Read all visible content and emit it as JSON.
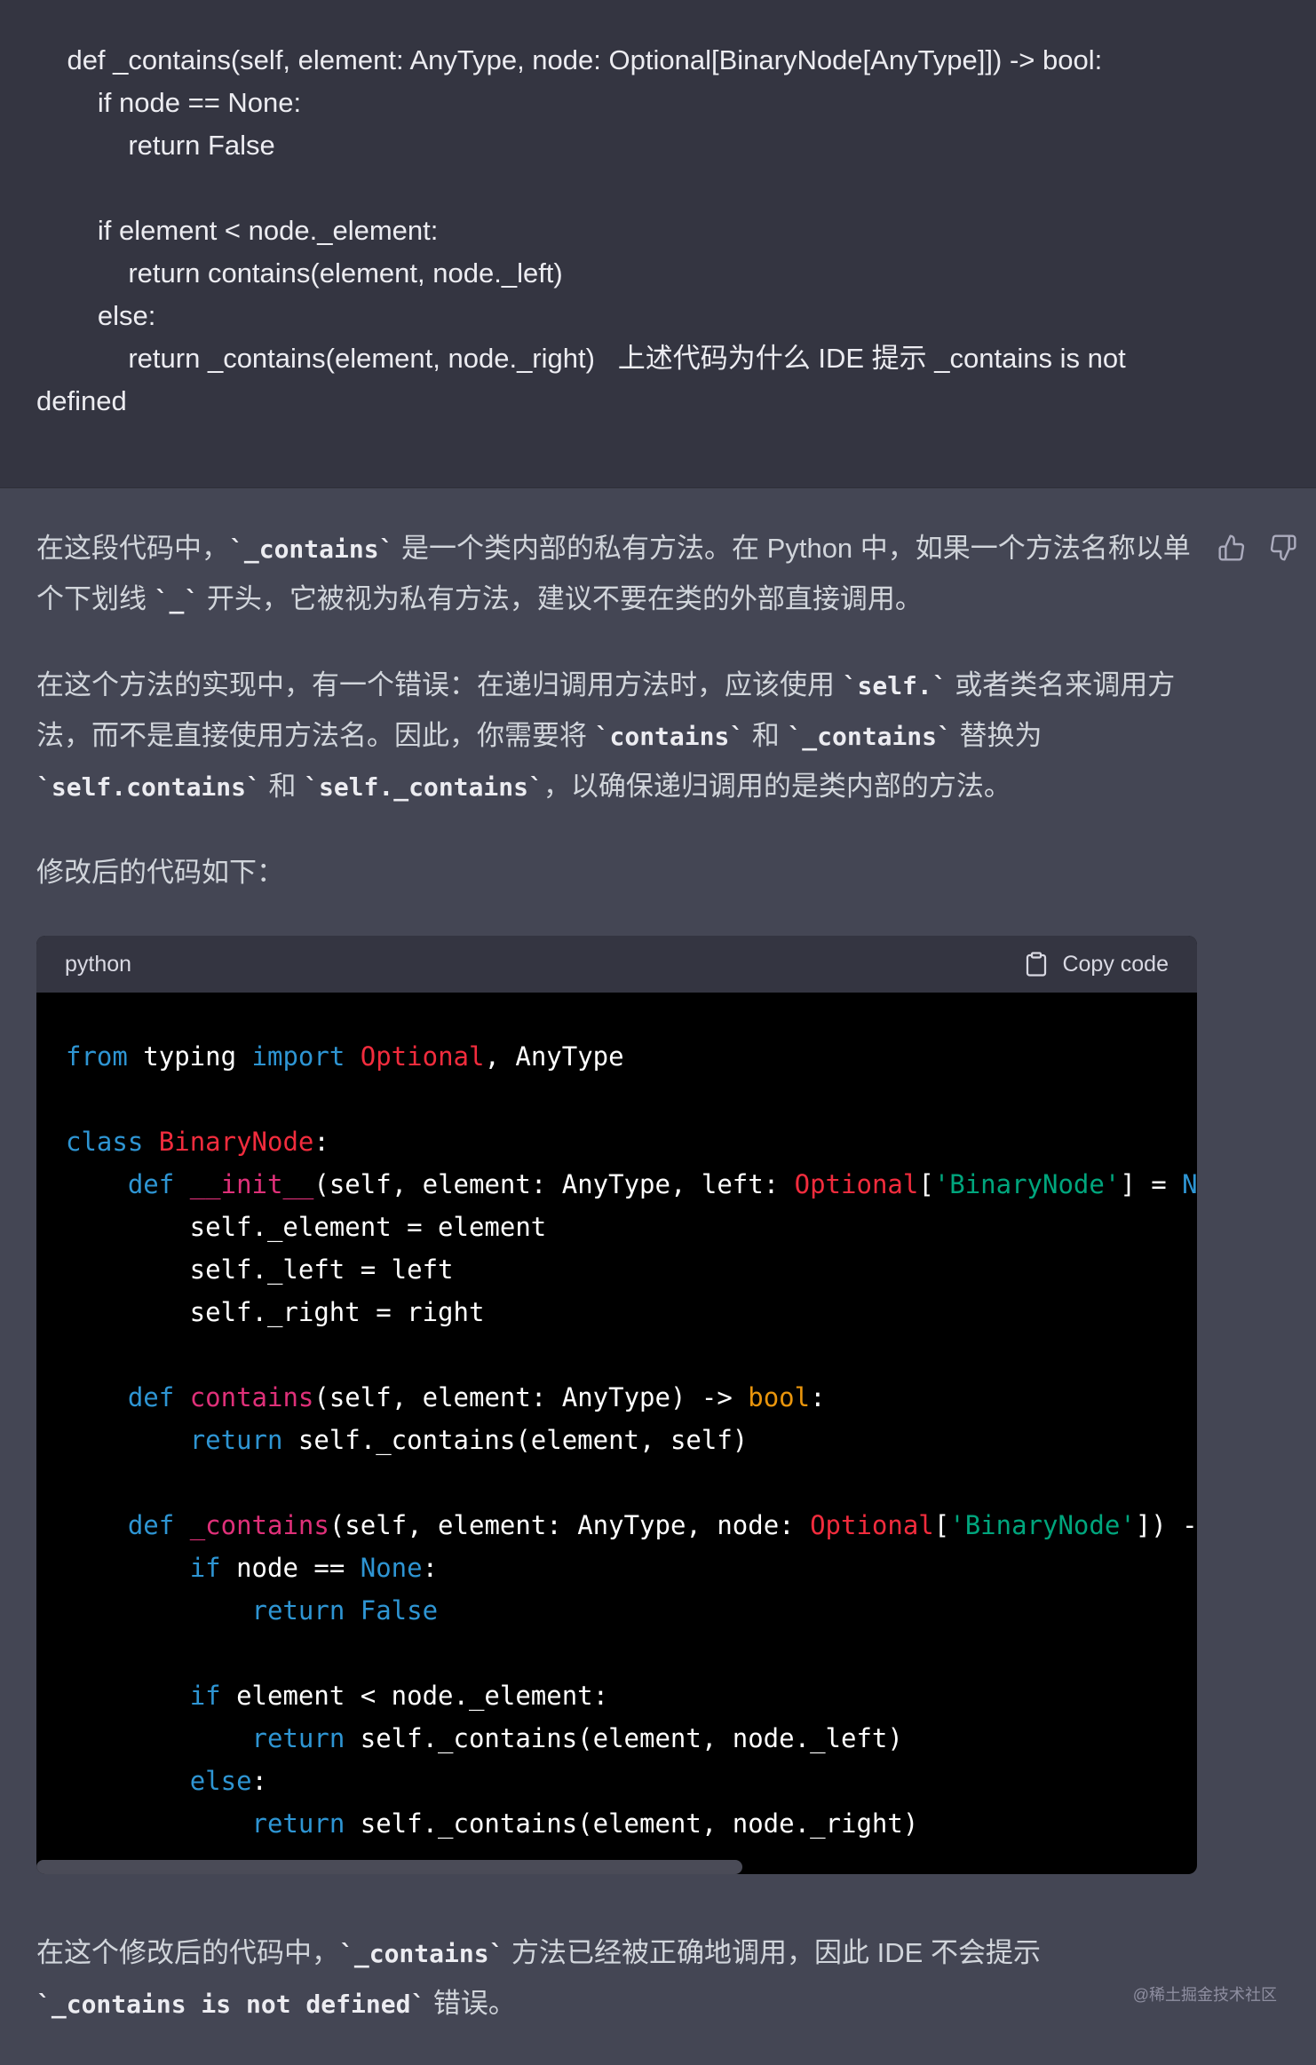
{
  "user_message": "    def _contains(self, element: AnyType, node: Optional[BinaryNode[AnyType]]) -> bool:\n        if node == None:\n            return False\n\n        if element < node._element:\n            return contains(element, node._left)\n        else:\n            return _contains(element, node._right)   上述代码为什么 IDE 提示 _contains is not defined",
  "assistant": {
    "p1": {
      "a": "在这段代码中，",
      "c1": "`_contains`",
      "b": " 是一个类内部的私有方法。在 Python 中，如果一个方法名称以单个下划线 ",
      "c2": "`_`",
      "d": " 开头，它被视为私有方法，建议不要在类的外部直接调用。"
    },
    "p2": {
      "a": "在这个方法的实现中，有一个错误：在递归调用方法时，应该使用 ",
      "c1": "`self.`",
      "b": " 或者类名来调用方法，而不是直接使用方法名。因此，你需要将 ",
      "c2": "`contains`",
      "d": " 和 ",
      "c3": "`_contains`",
      "e": " 替换为 ",
      "c4": "`self.contains`",
      "f": " 和 ",
      "c5": "`self._contains`",
      "g": "，以确保递归调用的是类内部的方法。"
    },
    "p3": "修改后的代码如下：",
    "p4": {
      "a": "在这个修改后的代码中，",
      "c1": "`_contains`",
      "b": " 方法已经被正确地调用，因此 IDE 不会提示 ",
      "c2": "`_contains is not defined`",
      "d": " 错误。"
    }
  },
  "code_block": {
    "language": "python",
    "copy_label": "Copy code"
  },
  "feedback": {
    "thumbs_up": "thumbs-up-icon",
    "thumbs_down": "thumbs-down-icon"
  },
  "watermark": "@稀土掘金技术社区",
  "colors": {
    "user_bg": "#343541",
    "assistant_bg": "#444654",
    "code_bg": "#000000",
    "keyword": "#2e95d3",
    "type": "#f22c3d",
    "function": "#df3079",
    "string": "#00a67d",
    "builtin": "#e9950c"
  }
}
